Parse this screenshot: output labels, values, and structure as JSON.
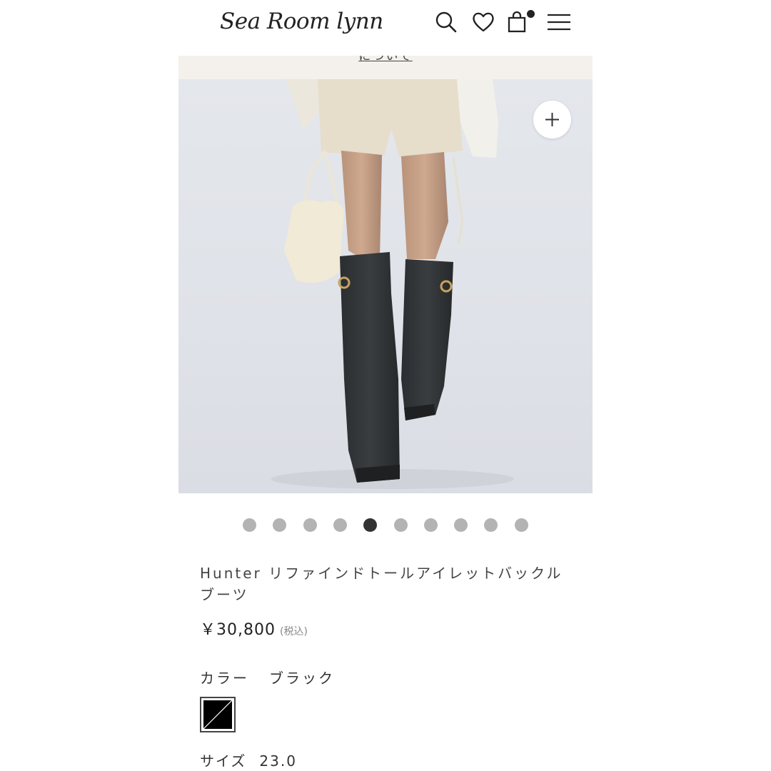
{
  "header": {
    "logo": "Sea Room lynn",
    "icons": [
      "search-icon",
      "heart-icon",
      "shopping-bag-icon",
      "menu-icon"
    ],
    "cart_has_items": true
  },
  "notice": {
    "link_text": "について"
  },
  "product_image": {
    "zoom_icon": "plus-icon",
    "carousel": {
      "total": 10,
      "active_index": 5
    }
  },
  "product": {
    "title": "Hunter リファインドトールアイレットバックルブーツ",
    "price": "￥30,800",
    "tax_note": "(税込)",
    "color_label": "カラー",
    "color_value": "ブラック",
    "swatch_color": "#000000",
    "size_label": "サイズ",
    "size_value": "23.0"
  },
  "colors": {
    "notice_bg": "#f4f1ec",
    "dot_inactive": "#b3b3b3",
    "dot_active": "#333333"
  }
}
